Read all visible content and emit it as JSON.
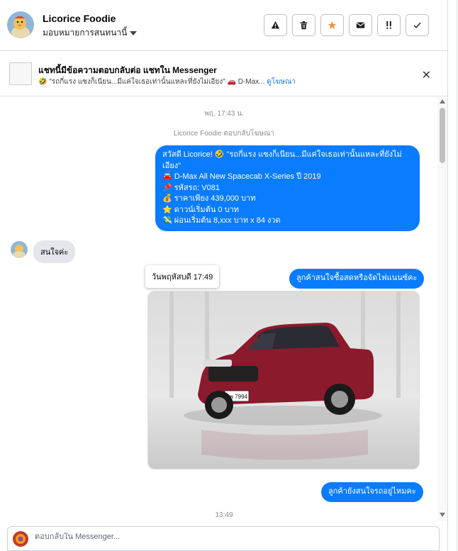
{
  "header": {
    "name": "Licorice Foodie",
    "assign_label": "มอบหมายการสนทนานี้",
    "actions": [
      {
        "name": "spam-button",
        "icon": "warning-icon"
      },
      {
        "name": "delete-button",
        "icon": "trash-icon"
      },
      {
        "name": "star-button",
        "icon": "star-icon"
      },
      {
        "name": "mark-unread-button",
        "icon": "mail-icon"
      },
      {
        "name": "follow-up-button",
        "icon": "exclamation-icon"
      },
      {
        "name": "done-button",
        "icon": "check-icon"
      }
    ]
  },
  "banner": {
    "title": "แชทนี้มีข้อความตอบกลับต่อ แชทใน Messenger",
    "subtitle": "🤣 \"รถกี่แรง แซงก็เนียน...มีแค่ใจเธอเท่านั้นแหละที่ยังไม่เอียง\" 🚗 D-Max...",
    "link": "ดูโฆษณา"
  },
  "conversation": {
    "timestamp_top": "พฤ, 17:43 น.",
    "reply_note": "Licorice Foodie ตอบกลับโฆษณา",
    "ad_message_lines": [
      "สวัสดี Licorice! 🤣 \"รถกี่แรง แซงก็เนียน...มีแค่ใจเธอเท่านั้นแหละที่ยังไม่เอียง\"",
      "🚘 D-Max All New Spacecab X-Series ปี 2019",
      "📌 รหัสรถ: V081",
      "💰 ราคาเพียง 439,000 บาท",
      "⭐ ดาวน์เริ่มต้น 0 บาท",
      "💸 ผ่อนเริ่มต้น 8,xxx บาท x 84 งวด",
      "."
    ],
    "incoming_message": "สนใจค่ะ",
    "tooltip": "วันพฤหัสบดี 17:49",
    "outgoing_1": "ลูกค้าสนใจซื้อสดหรือจัดไฟแนนซ์คะ",
    "plate": "ผพ 7994",
    "outgoing_2": "ลูกค้ายังสนใจรถอยู่ไหมคะ",
    "timestamp_bottom": "13:49"
  },
  "composer": {
    "placeholder": "ตอบกลับใน Messenger..."
  },
  "colors": {
    "accent": "#0a7cff",
    "star": "#f7923b"
  }
}
